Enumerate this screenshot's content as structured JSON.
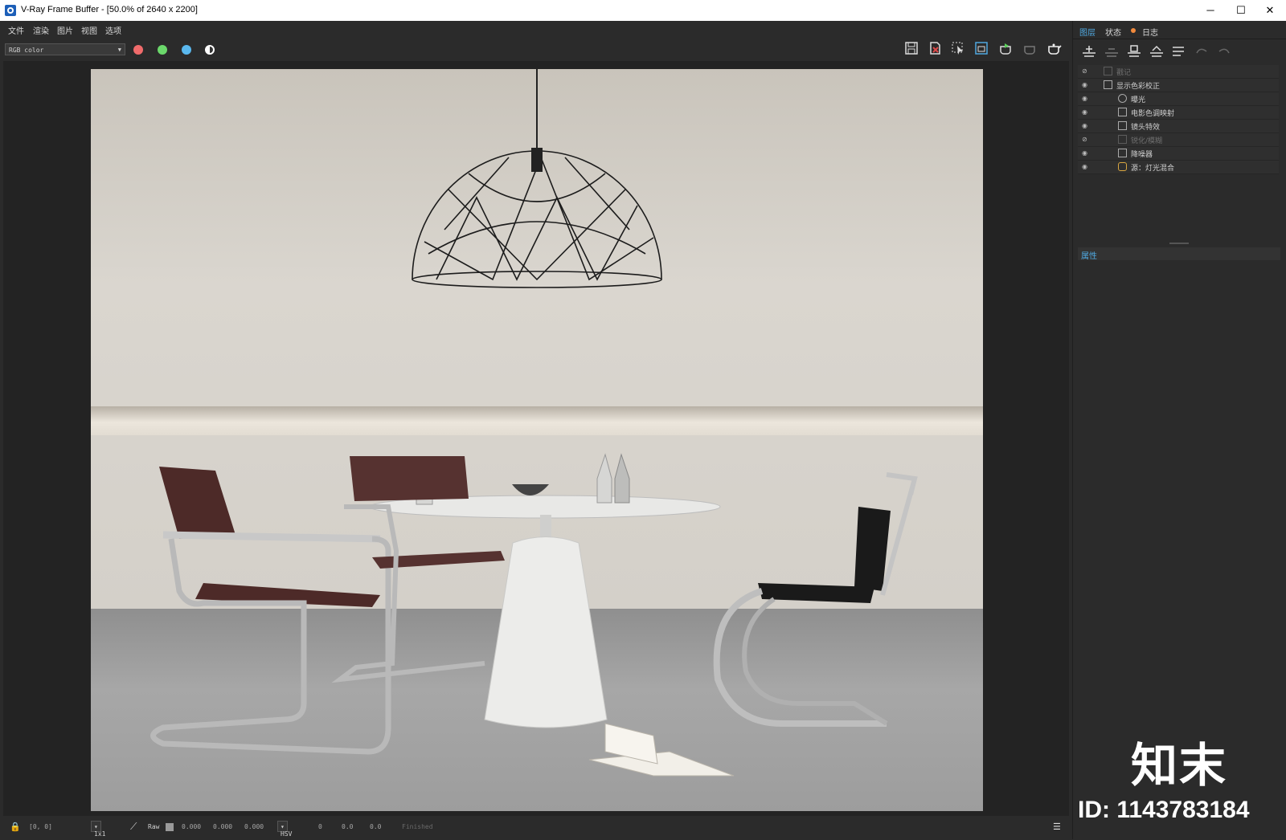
{
  "window": {
    "title": "V-Ray Frame Buffer - [50.0% of 2640 x 2200]",
    "minimize": "─",
    "maximize": "☐",
    "close": "✕"
  },
  "menu": [
    "文件",
    "渲染",
    "图片",
    "视图",
    "选项"
  ],
  "toolbar": {
    "channel": "RGB color",
    "colors": {
      "red": "#f06b6b",
      "green": "#6bd86b",
      "blue": "#5ab8ee"
    }
  },
  "panel": {
    "tabs": [
      "图层",
      "状态",
      "日志"
    ],
    "layers": [
      {
        "label": "戳记",
        "visible": false,
        "indent": 0
      },
      {
        "label": "显示色彩校正",
        "visible": true,
        "indent": 0
      },
      {
        "label": "曝光",
        "visible": true,
        "indent": 1
      },
      {
        "label": "电影色调映射",
        "visible": true,
        "indent": 1
      },
      {
        "label": "镜头特效",
        "visible": true,
        "indent": 1
      },
      {
        "label": "锐化/模糊",
        "visible": false,
        "indent": 1
      },
      {
        "label": "降噪器",
        "visible": true,
        "indent": 1
      },
      {
        "label": "源：灯光混合",
        "visible": true,
        "indent": 1
      }
    ],
    "properties_label": "属性"
  },
  "status": {
    "coords": "[0, 0]",
    "zoom": "1x1",
    "raw": "Raw",
    "values": [
      "0.000",
      "0.000",
      "0.000"
    ],
    "mode": "HSV",
    "hsv": [
      "0",
      "0.0",
      "0.0"
    ],
    "state": "Finished"
  },
  "watermark": {
    "brand": "知末",
    "id": "ID: 1143783184"
  }
}
